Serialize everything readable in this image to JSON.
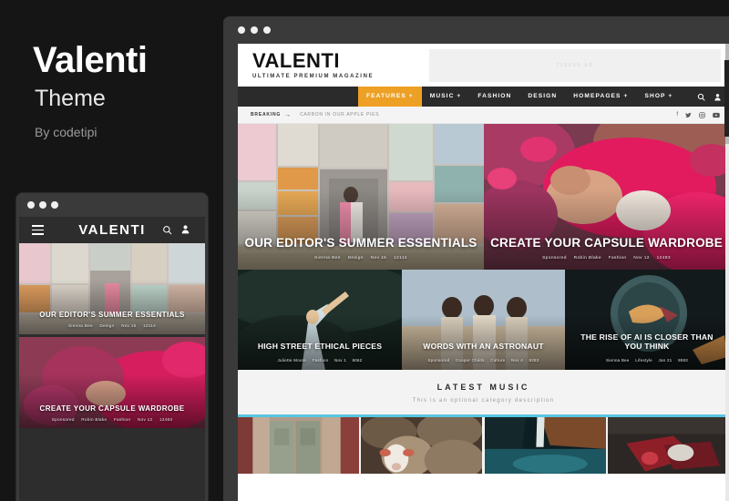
{
  "promo": {
    "title": "Valenti",
    "subtitle": "Theme",
    "author": "By codetipi"
  },
  "mobile": {
    "window_dots": [
      "dot",
      "dot",
      "dot"
    ],
    "header": {
      "menu_icon": "hamburger-menu-icon",
      "logo": "VALENTI",
      "search_icon": "search-icon",
      "user_icon": "user-icon"
    },
    "cards": [
      {
        "title": "OUR EDITOR'S SUMMER ESSENTIALS",
        "author": "Sienna Bee",
        "category": "Design",
        "date": "Nov 15",
        "views": "12114",
        "sponsored": ""
      },
      {
        "title": "CREATE YOUR CAPSULE WARDROBE",
        "author": "Robin Blake",
        "category": "Fashion",
        "date": "Nov 12",
        "views": "12483",
        "sponsored": "Sponsored"
      }
    ]
  },
  "browser": {
    "window_dots": [
      "dot",
      "dot",
      "dot"
    ],
    "site": {
      "logo_name": "VALENTI",
      "logo_tagline": "ULTIMATE PREMIUM MAGAZINE",
      "ad_label": "728X90 AD",
      "nav": [
        {
          "label": "FEATURES +",
          "active": true
        },
        {
          "label": "MUSIC +",
          "active": false
        },
        {
          "label": "FASHION",
          "active": false
        },
        {
          "label": "DESIGN",
          "active": false
        },
        {
          "label": "HOMEPAGES +",
          "active": false
        },
        {
          "label": "SHOP +",
          "active": false
        }
      ],
      "nav_icons": [
        "search-icon",
        "user-icon"
      ],
      "breaking": {
        "label": "BREAKING",
        "arrow": "→",
        "headline": "CARBON IN OUR APPLE PIES"
      },
      "social_icons": [
        "facebook-icon",
        "twitter-icon",
        "instagram-icon",
        "youtube-icon"
      ],
      "heroes": [
        {
          "title": "OUR EDITOR'S SUMMER ESSENTIALS",
          "sponsored": "",
          "author": "Sienna Bee",
          "category": "Design",
          "date": "Nov 15",
          "views": "12114"
        },
        {
          "title": "CREATE YOUR CAPSULE WARDROBE",
          "sponsored": "Sponsored",
          "author": "Robin Blake",
          "category": "Fashion",
          "date": "Nov 12",
          "views": "12483"
        }
      ],
      "cards": [
        {
          "title": "HIGH STREET ETHICAL PIECES",
          "sponsored": "",
          "author": "Juliette Moore",
          "category": "Fashion",
          "date": "Nov 1",
          "views": "6062"
        },
        {
          "title": "WORDS WITH AN ASTRONAUT",
          "sponsored": "Sponsored",
          "author": "Cooper Childs",
          "category": "Culture",
          "date": "Nov 4",
          "views": "8283"
        },
        {
          "title": "THE RISE OF AI IS CLOSER THAN YOU THINK",
          "sponsored": "",
          "author": "Sienna Bee",
          "category": "Lifestyle",
          "date": "Jan 21",
          "views": "9083"
        }
      ],
      "section": {
        "title": "LATEST MUSIC",
        "description": "This is an optional category description",
        "accent_color": "#57c6e0",
        "thumbs": [
          "old-doors-photo",
          "sheep-flock-photo",
          "waterfall-lagoon-photo",
          "red-fabric-photo"
        ]
      }
    }
  },
  "colors": {
    "background": "#151515",
    "nav_active": "#eda024",
    "chrome": "#3a3a3a",
    "accent": "#57c6e0"
  }
}
